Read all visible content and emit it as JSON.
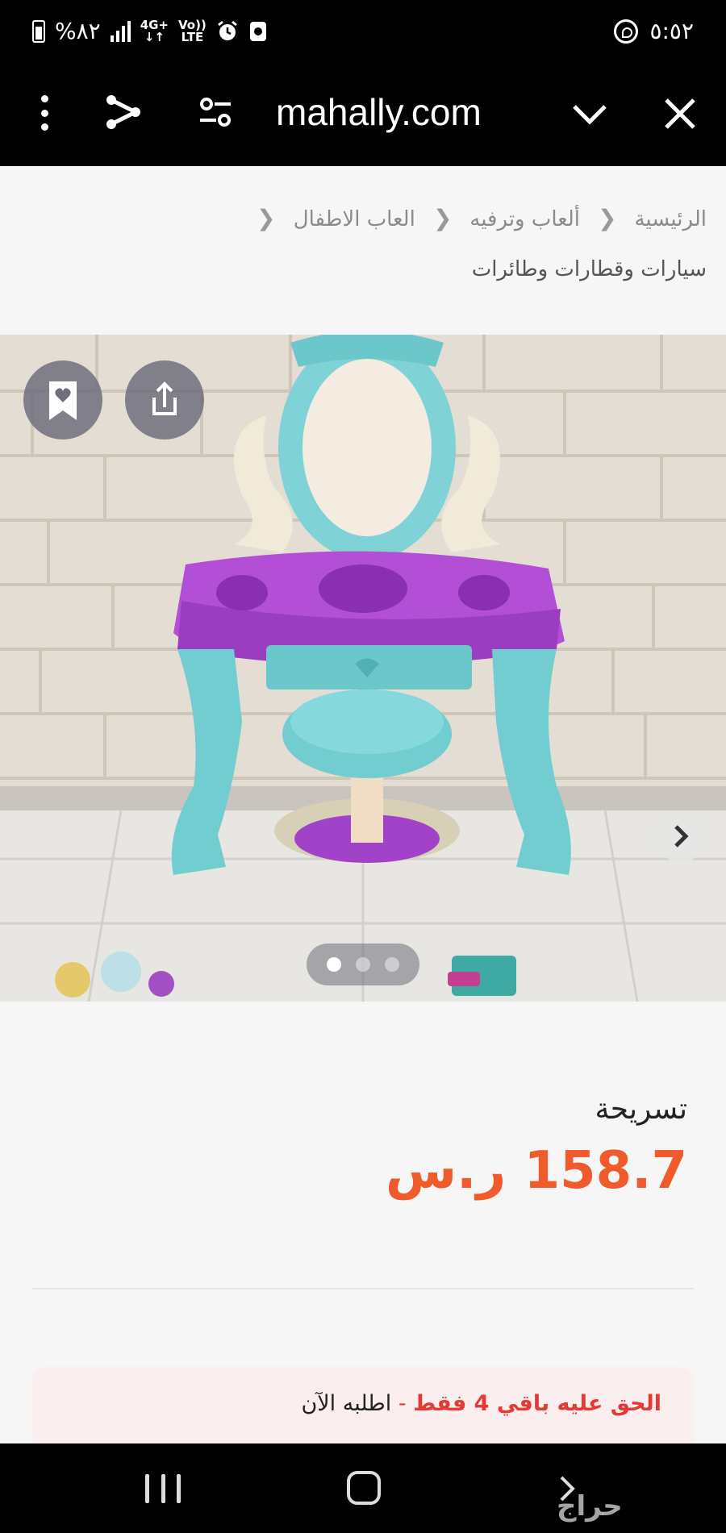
{
  "status_bar": {
    "battery_text": "%٨٢",
    "network_top": "4G+",
    "volte_top": "Vo))",
    "volte_bottom": "LTE",
    "time": "٥:٥٢"
  },
  "browser": {
    "url": "mahally.com"
  },
  "breadcrumb": {
    "items": [
      "الرئيسية",
      "ألعاب وترفيه",
      "العاب الاطفال",
      "سيارات وقطارات وطائرات"
    ]
  },
  "gallery": {
    "image_subject": "pink and teal toy vanity table with mirror and stool",
    "slide_count": 3,
    "active_slide": 1
  },
  "product": {
    "title": "تسريحة",
    "price": "158.7 ر.س",
    "price_color": "#ef5b2b"
  },
  "stock": {
    "highlight": "الحق عليه باقي 4 فقط",
    "separator": " - ",
    "cta": "اطلبه الآن"
  },
  "watermark": {
    "text": "حراج"
  },
  "icons": {
    "menu": "more-vert-icon",
    "share": "share-icon",
    "settings": "tune-icon",
    "collapse": "chevron-down-icon",
    "close": "close-icon",
    "bookmark": "bookmark-heart-icon",
    "upload": "share-upload-icon",
    "next": "chevron-right-icon"
  }
}
